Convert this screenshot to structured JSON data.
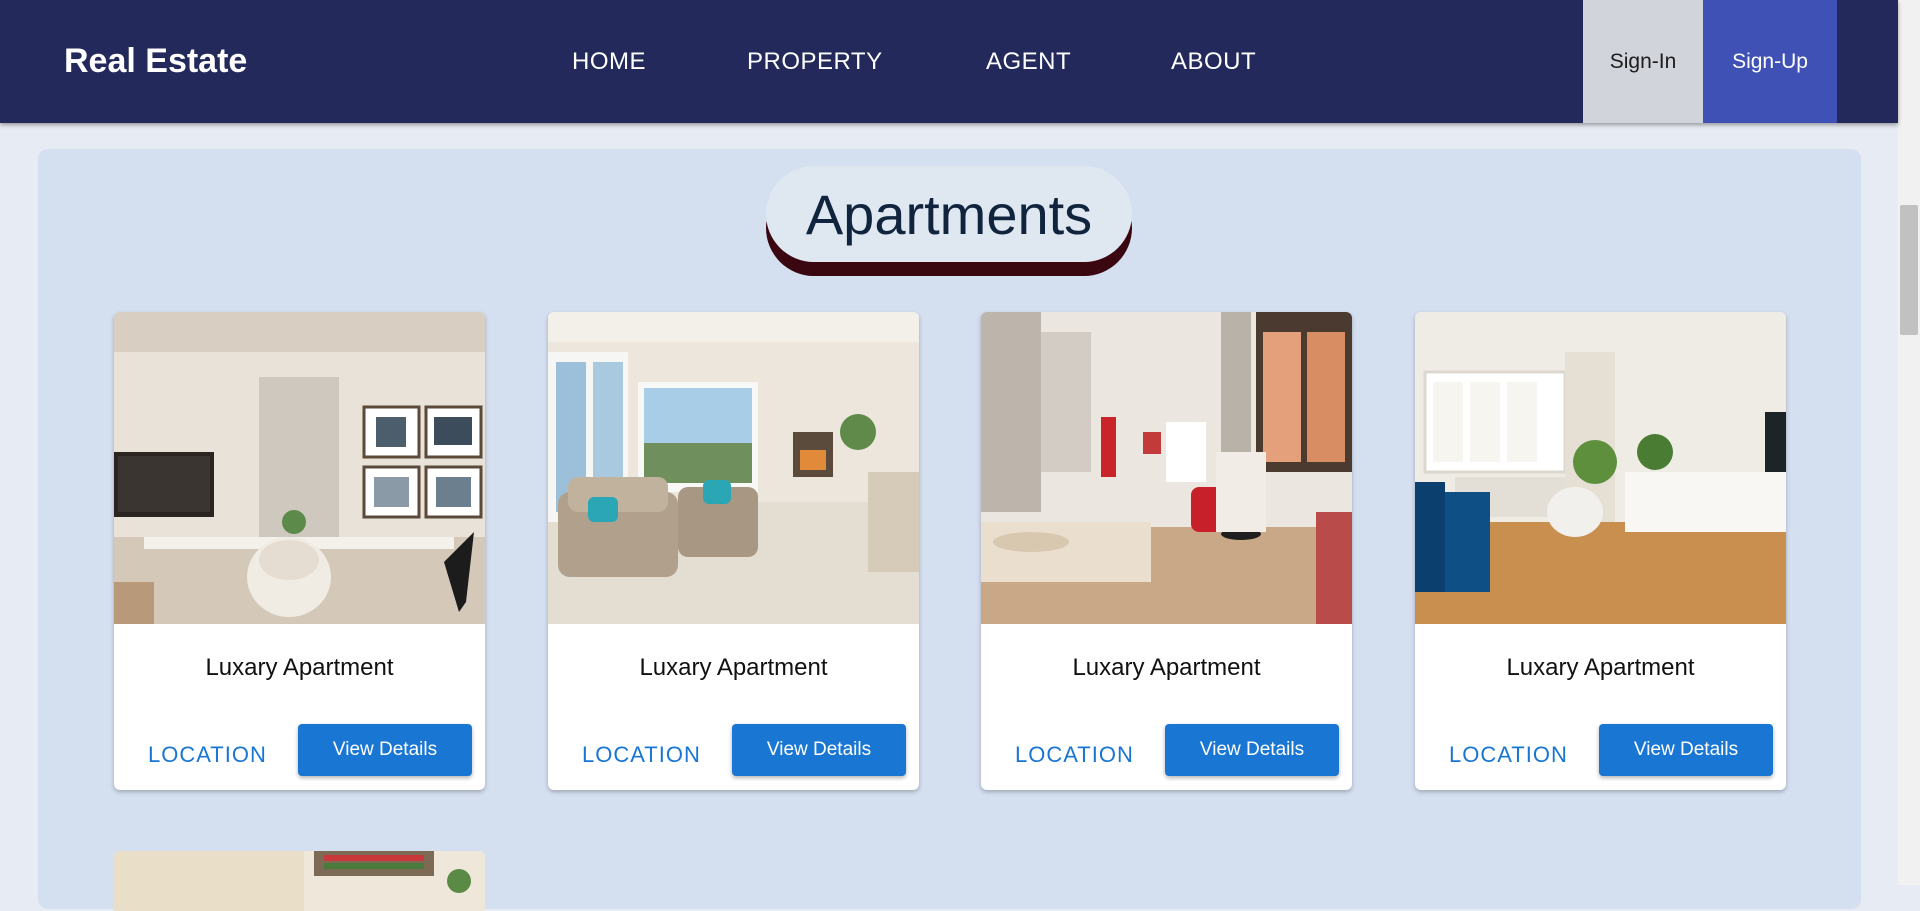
{
  "header": {
    "brand": "Real Estate",
    "nav": [
      {
        "label": "HOME"
      },
      {
        "label": "PROPERTY"
      },
      {
        "label": "AGENT"
      },
      {
        "label": "ABOUT"
      }
    ],
    "signin_label": "Sign-In",
    "signup_label": "Sign-Up"
  },
  "section": {
    "title": "Apartments"
  },
  "cards": [
    {
      "title": "Luxary Apartment",
      "location_label": "LOCATION",
      "button_label": "View Details"
    },
    {
      "title": "Luxary Apartment",
      "location_label": "LOCATION",
      "button_label": "View Details"
    },
    {
      "title": "Luxary Apartment",
      "location_label": "LOCATION",
      "button_label": "View Details"
    },
    {
      "title": "Luxary Apartment",
      "location_label": "LOCATION",
      "button_label": "View Details"
    }
  ],
  "colors": {
    "navbar": "#232a5b",
    "signup": "#3f51b5",
    "signin": "#d1d4db",
    "panel": "#d4dff0",
    "accent": "#1976d2",
    "title_shadow": "#3a0710"
  }
}
